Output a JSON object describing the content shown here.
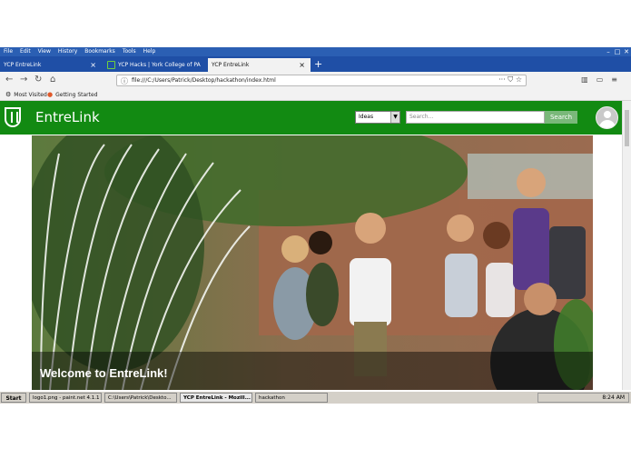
{
  "browser": {
    "menus": [
      "File",
      "Edit",
      "View",
      "History",
      "Bookmarks",
      "Tools",
      "Help"
    ],
    "tabs": [
      {
        "label": "YCP EntreLink"
      },
      {
        "label": "YCP Hacks | York College of PA"
      },
      {
        "label": "YCP EntreLink"
      }
    ],
    "url": "file:///C:/Users/Patrick/Desktop/hackathon/index.html",
    "bookmarks": [
      "Most Visited",
      "Getting Started"
    ]
  },
  "site": {
    "brand": "EntreLink",
    "category_selected": "Ideas",
    "search_placeholder": "Search...",
    "search_button": "Search",
    "hero_caption": "Welcome to EntreLink!"
  },
  "taskbar": {
    "start_label": "Start",
    "tasks": [
      {
        "label": "logo1.png - paint.net 4.1.1"
      },
      {
        "label": "C:\\Users\\Patrick\\Deskto..."
      },
      {
        "label": "YCP EntreLink - Mozill..."
      },
      {
        "label": "hackathon"
      }
    ],
    "clock": "8:24 AM"
  },
  "colors": {
    "header_green": "#128a12",
    "titlebar_blue": "#2b5fb3"
  }
}
